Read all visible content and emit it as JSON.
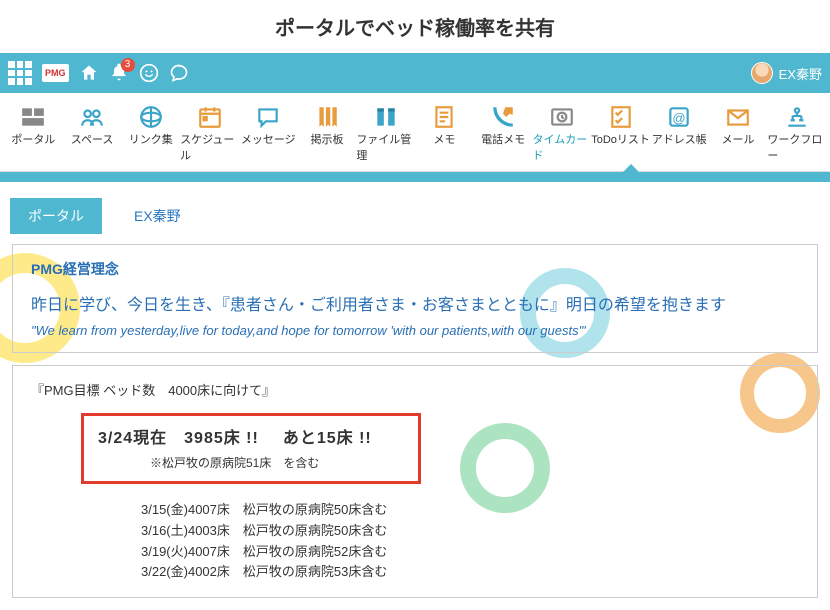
{
  "page_title": "ポータルでベッド稼働率を共有",
  "topbar": {
    "pmg_badge": "PMG",
    "bell_count": "3",
    "user_name": "EX秦野"
  },
  "nav": {
    "items": [
      {
        "label": "ポータル",
        "selected": false
      },
      {
        "label": "スペース",
        "selected": false
      },
      {
        "label": "リンク集",
        "selected": false
      },
      {
        "label": "スケジュール",
        "selected": false
      },
      {
        "label": "メッセージ",
        "selected": false
      },
      {
        "label": "掲示板",
        "selected": false
      },
      {
        "label": "ファイル管理",
        "selected": false
      },
      {
        "label": "メモ",
        "selected": false
      },
      {
        "label": "電話メモ",
        "selected": false
      },
      {
        "label": "タイムカード",
        "selected": true
      },
      {
        "label": "ToDoリスト",
        "selected": false
      },
      {
        "label": "アドレス帳",
        "selected": false
      },
      {
        "label": "メール",
        "selected": false
      },
      {
        "label": "ワークフロー",
        "selected": false
      }
    ]
  },
  "tabs": {
    "items": [
      {
        "label": "ポータル",
        "active": true
      },
      {
        "label": "EX秦野",
        "active": false
      }
    ]
  },
  "philosophy": {
    "title": "PMG経営理念",
    "line_ja": "昨日に学び、今日を生き、『患者さん・ご利用者さま・お客さまとともに』明日の希望を抱きます",
    "line_en": "\"We learn from yesterday,live for today,and hope for tomorrow 'with our patients,with our guests'\""
  },
  "goal": {
    "title": "『PMG目標 ベッド数　4000床に向けて』",
    "highlight_main": "3/24現在　3985床 !!",
    "highlight_remain": "あと15床 !!",
    "highlight_note": "※松戸牧の原病院51床　を含む",
    "history": [
      "3/15(金)4007床　松戸牧の原病院50床含む",
      "3/16(土)4003床　松戸牧の原病院50床含む",
      "3/19(火)4007床　松戸牧の原病院52床含む",
      "3/22(金)4002床　松戸牧の原病院53床含む"
    ]
  }
}
